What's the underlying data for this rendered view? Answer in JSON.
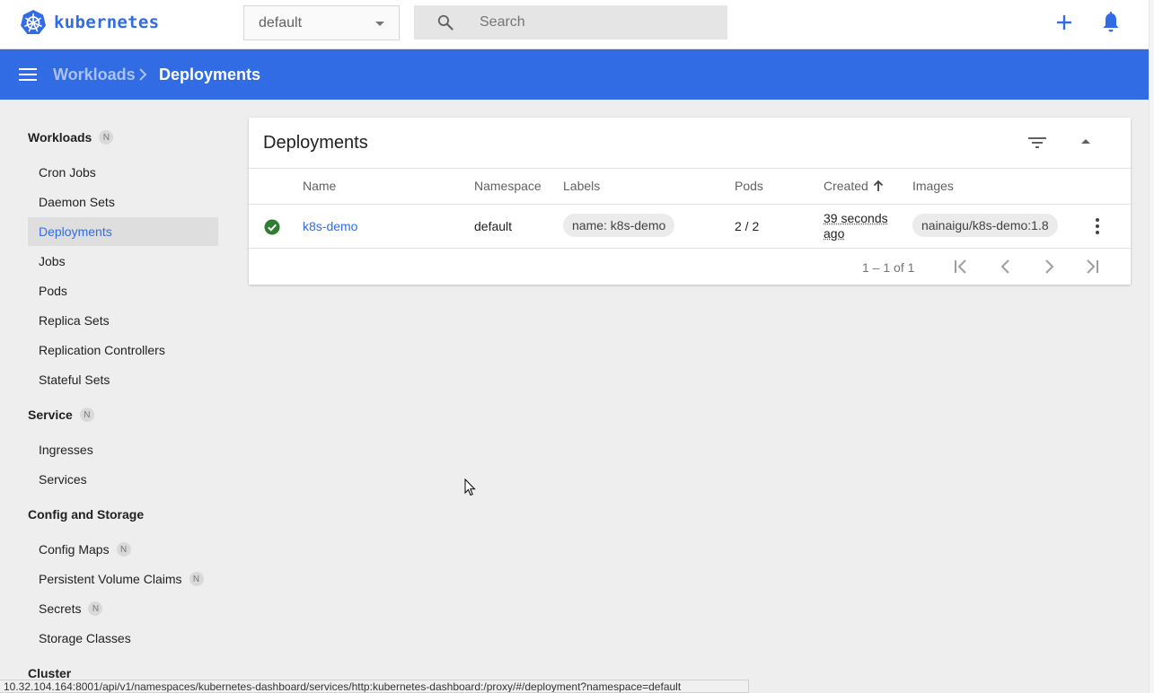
{
  "app": {
    "title": "kubernetes"
  },
  "topbar": {
    "namespace_value": "default",
    "search_placeholder": "Search"
  },
  "breadcrumb": {
    "parent": "Workloads",
    "current": "Deployments"
  },
  "sidebar": {
    "sections": [
      {
        "title": "Workloads",
        "badge": "N"
      },
      {
        "title": "Service",
        "badge": "N"
      },
      {
        "title": "Config and Storage",
        "badge": ""
      },
      {
        "title": "Cluster",
        "badge": ""
      }
    ],
    "workloads": [
      "Cron Jobs",
      "Daemon Sets",
      "Deployments",
      "Jobs",
      "Pods",
      "Replica Sets",
      "Replication Controllers",
      "Stateful Sets"
    ],
    "service": [
      "Ingresses",
      "Services"
    ],
    "config": [
      {
        "label": "Config Maps",
        "badge": "N"
      },
      {
        "label": "Persistent Volume Claims",
        "badge": "N"
      },
      {
        "label": "Secrets",
        "badge": "N"
      },
      {
        "label": "Storage Classes",
        "badge": ""
      }
    ],
    "active": "Deployments"
  },
  "card": {
    "title": "Deployments",
    "columns": [
      "Name",
      "Namespace",
      "Labels",
      "Pods",
      "Created",
      "Images"
    ],
    "rows": [
      {
        "status": "running",
        "name": "k8s-demo",
        "namespace": "default",
        "label": "name: k8s-demo",
        "pods": "2 / 2",
        "created": "39 seconds ago",
        "image": "nainaigu/k8s-demo:1.8"
      }
    ],
    "pagination": "1 – 1 of 1"
  },
  "statusbar": {
    "url": "10.32.104.164:8001/api/v1/namespaces/kubernetes-dashboard/services/http:kubernetes-dashboard:/proxy/#/deployment?namespace=default"
  },
  "colors": {
    "brand": "#326ce5",
    "success": "#2e7d32"
  }
}
